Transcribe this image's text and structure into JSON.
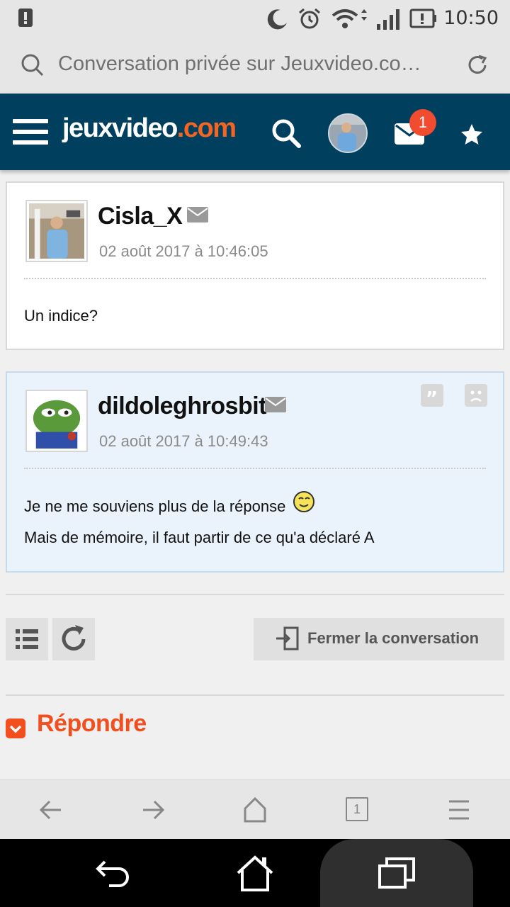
{
  "status_bar": {
    "time": "10:50",
    "icons": [
      "notification-icon",
      "moon-icon",
      "alarm-icon",
      "wifi-icon",
      "signal-icon",
      "battery-icon"
    ]
  },
  "url_bar": {
    "title": "Conversation privée sur Jeuxvideo.co…"
  },
  "site_header": {
    "logo_main": "jeuxvideo",
    "logo_dot": ".com",
    "mail_badge": "1",
    "brand_color": "#003f5e",
    "accent_color": "#f26522"
  },
  "messages": [
    {
      "pseudo": "Cisla_X",
      "date": "02 août 2017 à 10:46:05",
      "lines": [
        "Un indice?"
      ]
    },
    {
      "pseudo": "dildoleghrosbit",
      "date": "02 août 2017 à 10:49:43",
      "lines": [
        "Je ne me souviens plus de la réponse",
        "Mais de mémoire, il faut partir de ce qu'a déclaré A"
      ]
    }
  ],
  "actions": {
    "close_label": "Fermer la conversation"
  },
  "reply": {
    "label": "Répondre"
  },
  "browser_bar": {
    "tab_count": "1"
  }
}
